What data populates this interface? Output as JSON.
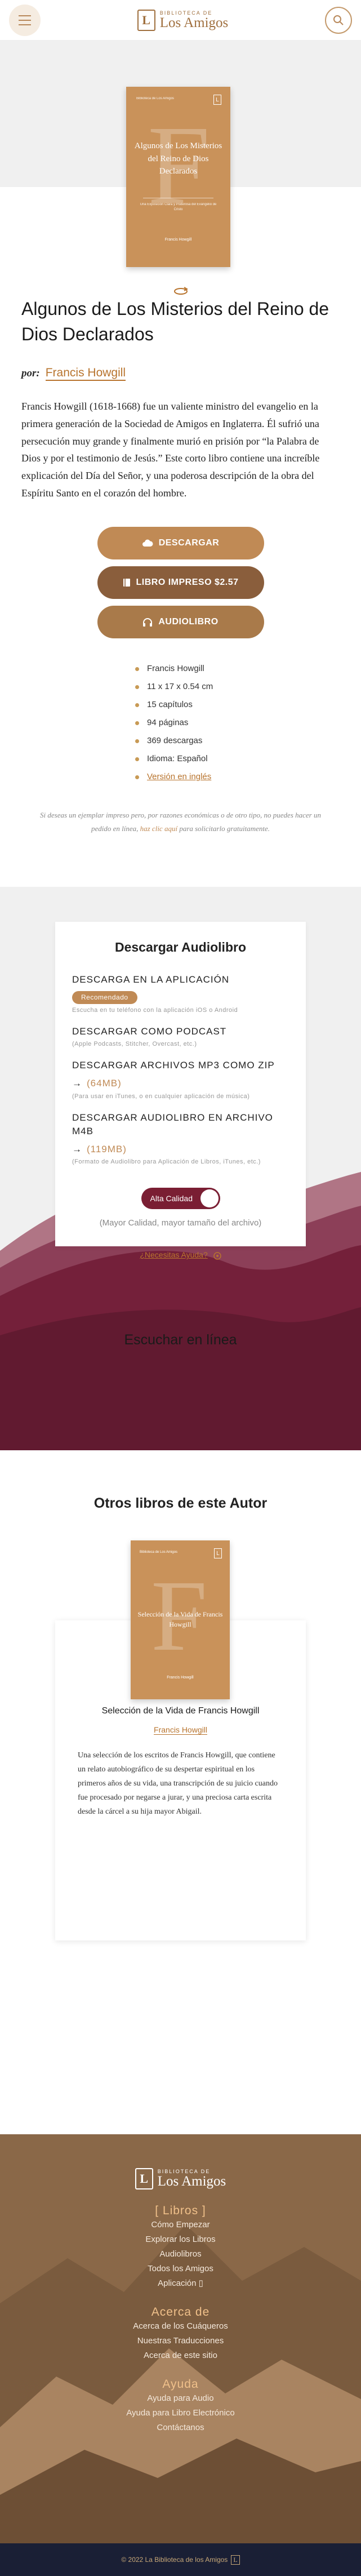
{
  "header": {
    "logo_small": "BIBLIOTECA DE",
    "logo_big": "Los Amigos",
    "logo_mark": "L"
  },
  "cover": {
    "publisher": "Biblioteca de Los Amigos",
    "title": "Algunos de Los Misterios del Reino de Dios Declarados",
    "subtitle": "Una Exposición Clara y Poderosa del Evangelio de Cristo",
    "author": "Francis Howgill"
  },
  "book": {
    "title": "Algunos de Los Misterios del Reino de Dios Declarados",
    "by_label": "por:",
    "author": "Francis Howgill",
    "description": "Francis Howgill (1618-1668) fue un valiente ministro del evangelio en la primera generación de la Sociedad de Amigos en Inglaterra. Él sufrió una persecución muy grande y finalmente murió en prisión por “la Palabra de Dios y por el testimonio de Jesús.” Este corto libro contiene una increíble explicación del Día del Señor, y una poderosa descripción de la obra del Espíritu Santo en el corazón del hombre."
  },
  "buttons": {
    "download": "DESCARGAR",
    "print": "LIBRO IMPRESO $2.57",
    "audio": "AUDIOLIBRO"
  },
  "meta": [
    "Francis Howgill",
    "11 x 17 x 0.54 cm",
    "15 capítulos",
    "94 páginas",
    "369 descargas",
    "Idioma: Español",
    "Versión en inglés"
  ],
  "note": {
    "pre": "Si deseas un ejemplar impreso pero, por razones económicas o de otro tipo, no puedes hacer un pedido en línea,",
    "link": "haz clic aquí",
    "post": "para solicitarlo gratuitamente."
  },
  "audiobook": {
    "title": "Descargar Audiolibro",
    "options": [
      {
        "title": "DESCARGA EN LA APLICACIÓN",
        "badge": "Recomendado",
        "size": "",
        "sub": "Escucha en tu teléfono con la aplicación iOS o Android"
      },
      {
        "title": "DESCARGAR COMO PODCAST",
        "badge": "",
        "size": "",
        "sub": "(Apple Podcasts, Stitcher, Overcast, etc.)"
      },
      {
        "title": "DESCARGAR ARCHIVOS MP3 COMO ZIP",
        "badge": "",
        "size": "(64MB)",
        "sub": "(Para usar en iTunes, o en cualquier aplicación de música)"
      },
      {
        "title": "DESCARGAR AUDIOLIBRO EN ARCHIVO M4B",
        "badge": "",
        "size": "(119MB)",
        "sub": "(Formato de Audiolibro para Aplicación de Libros, iTunes, etc.)"
      }
    ],
    "toggle": "Alta Calidad",
    "quality_note": "(Mayor Calidad, mayor tamaño del archivo)",
    "help": "¿Necesitas Ayuda?",
    "listen": "Escuchar en línea"
  },
  "other": {
    "title": "Otros libros de este Autor",
    "book": {
      "cover_title": "Selección de la Vida de Francis Howgill",
      "cover_publisher": "Biblioteca de Los Amigos",
      "cover_author": "Francis Howgill",
      "title": "Selección de la Vida de Francis Howgill",
      "author": "Francis Howgill",
      "description": "Una selección de los escritos de Francis Howgill, que contiene un relato autobiográfico de su despertar espiritual en los primeros años de su vida, una transcripción de su juicio cuando fue procesado por negarse a jurar, y una preciosa carta escrita desde la cárcel a su hija mayor Abigail."
    }
  },
  "footer": {
    "logo_small": "BIBLIOTECA DE",
    "logo_big": "Los Amigos",
    "sections": [
      {
        "head": "[ Libros ]",
        "links": [
          "Cómo Empezar",
          "Explorar los Libros",
          "Audiolibros",
          "Todos los Amigos",
          "Aplicación"
        ]
      },
      {
        "head": "Acerca de",
        "links": [
          "Acerca de los Cuáqueros",
          "Nuestras Traducciones",
          "Acerca de este sitio"
        ]
      },
      {
        "head": "Ayuda",
        "links": [
          "Ayuda para Audio",
          "Ayuda para Libro Electrónico",
          "Contáctanos"
        ]
      }
    ],
    "copyright": "© 2022 La Biblioteca de los Amigos"
  },
  "colors": {
    "accent": "#c08a55",
    "accent_dark": "#8a5e3c",
    "burgundy": "#7a1e33",
    "footer_bar": "#1a1f35"
  }
}
